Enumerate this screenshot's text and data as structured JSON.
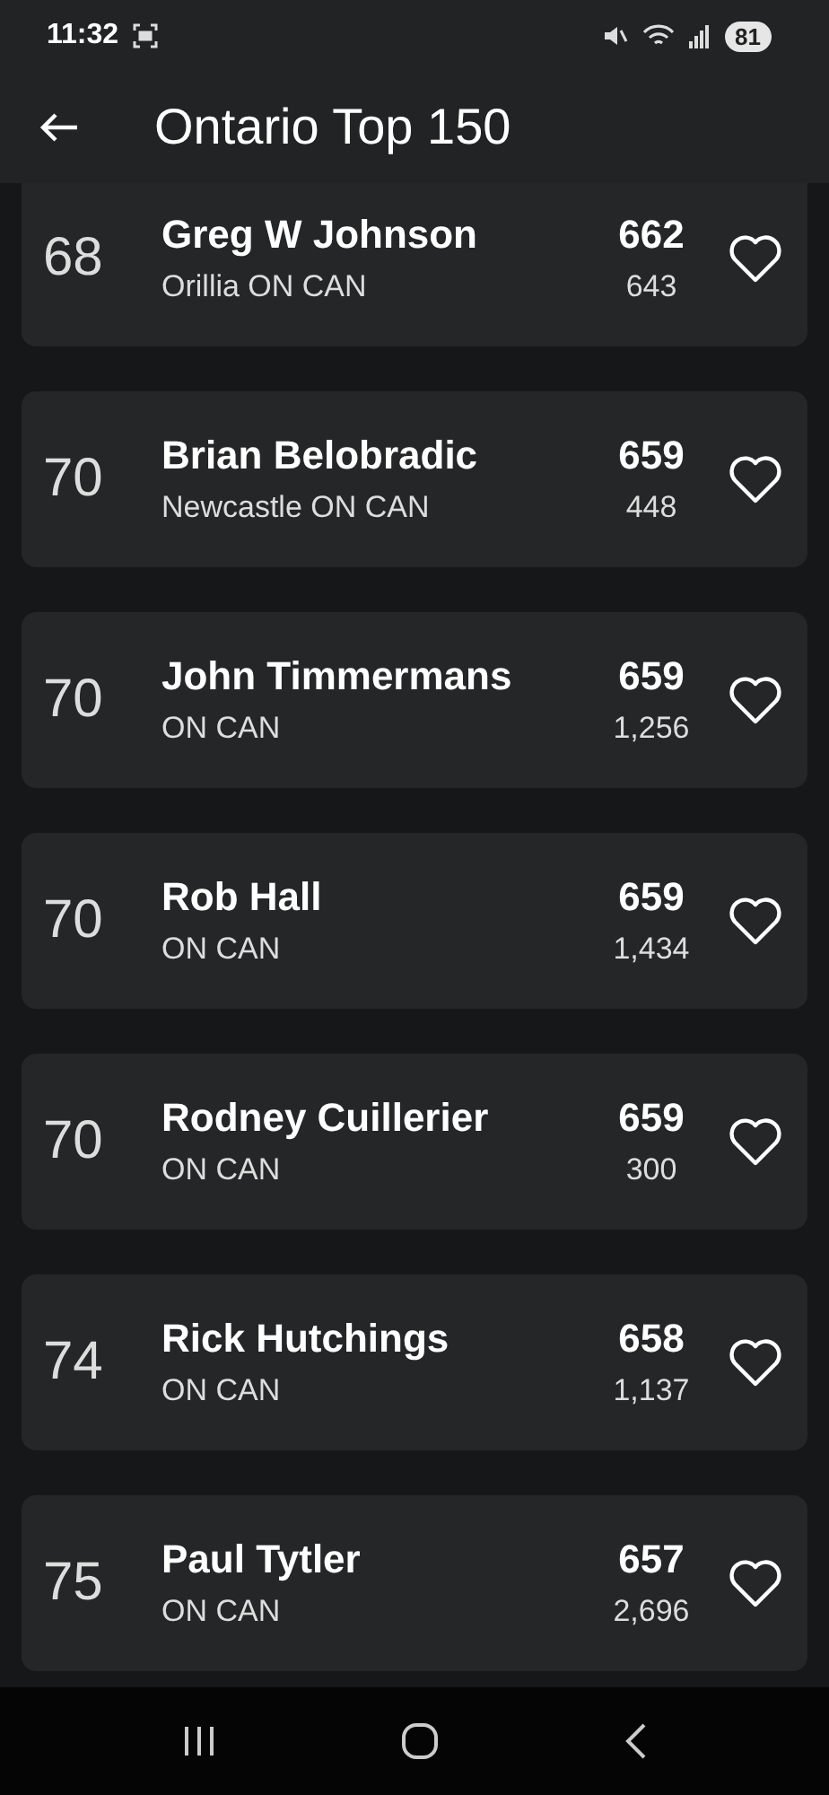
{
  "status_bar": {
    "time": "11:32",
    "battery": "81"
  },
  "app_bar": {
    "title": "Ontario Top 150"
  },
  "players": [
    {
      "rank": "68",
      "name": "Greg W Johnson",
      "location": "Orillia ON CAN",
      "score": "662",
      "count": "643",
      "favorite": false
    },
    {
      "rank": "70",
      "name": "Brian Belobradic",
      "location": "Newcastle ON CAN",
      "score": "659",
      "count": "448",
      "favorite": false
    },
    {
      "rank": "70",
      "name": "John Timmermans",
      "location": "ON CAN",
      "score": "659",
      "count": "1,256",
      "favorite": false
    },
    {
      "rank": "70",
      "name": "Rob Hall",
      "location": "ON CAN",
      "score": "659",
      "count": "1,434",
      "favorite": false
    },
    {
      "rank": "70",
      "name": "Rodney Cuillerier",
      "location": "ON CAN",
      "score": "659",
      "count": "300",
      "favorite": false
    },
    {
      "rank": "74",
      "name": "Rick Hutchings",
      "location": "ON CAN",
      "score": "658",
      "count": "1,137",
      "favorite": false
    },
    {
      "rank": "75",
      "name": "Paul Tytler",
      "location": "ON CAN",
      "score": "657",
      "count": "2,696",
      "favorite": false
    }
  ]
}
